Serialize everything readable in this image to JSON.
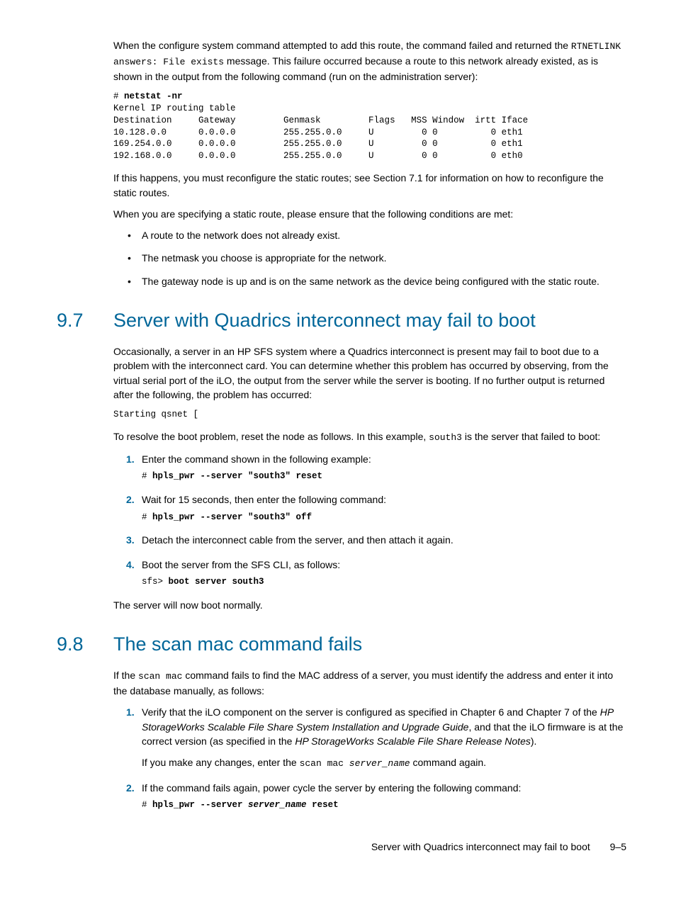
{
  "intro": {
    "p1_a": "When the configure system command attempted to add this route, the command failed and returned the ",
    "p1_code": "RTNETLINK answers: File exists",
    "p1_b": " message. This failure occurred because a route to this network already existed, as is shown in the output from the following command (run on the administration server):",
    "codeblock": "# netstat -nr\nKernel IP routing table\nDestination     Gateway         Genmask         Flags   MSS Window  irtt Iface\n10.128.0.0      0.0.0.0         255.255.0.0     U         0 0          0 eth1\n169.254.0.0     0.0.0.0         255.255.0.0     U         0 0          0 eth1\n192.168.0.0     0.0.0.0         255.255.0.0     U         0 0          0 eth0",
    "p2": "If this happens, you must reconfigure the static routes; see Section 7.1 for information on how to reconfigure the static routes.",
    "p3": "When you are specifying a static route, please ensure that the following conditions are met:",
    "bullets": [
      "A route to the network does not already exist.",
      "The netmask you choose is appropriate for the network.",
      "The gateway node is up and is on the same network as the device being configured with the static route."
    ]
  },
  "s97": {
    "num": "9.7",
    "title": "Server with Quadrics interconnect may fail to boot",
    "p1": "Occasionally, a server in an HP SFS system where a Quadrics interconnect is present may fail to boot due to a problem with the interconnect card. You can determine whether this problem has occurred by observing, from the virtual serial port of the iLO, the output from the server while the server is booting. If no further output is returned after the following, the problem has occurred:",
    "code1": "Starting qsnet [",
    "p2_a": "To resolve the boot problem, reset the node as follows. In this example, ",
    "p2_code": "south3",
    "p2_b": " is the server that failed to boot:",
    "steps": [
      {
        "text": "Enter the command shown in the following example:",
        "code_pre": "# ",
        "code_bold": "hpls_pwr --server \"south3\" reset"
      },
      {
        "text": "Wait for 15 seconds, then enter the following command:",
        "code_pre": "# ",
        "code_bold": "hpls_pwr --server \"south3\" off"
      },
      {
        "text": "Detach the interconnect cable from the server, and then attach it again."
      },
      {
        "text": "Boot the server from the SFS CLI, as follows:",
        "code_pre": "sfs> ",
        "code_bold": "boot server south3"
      }
    ],
    "p3": "The server will now boot normally."
  },
  "s98": {
    "num": "9.8",
    "title": "The scan mac command fails",
    "p1_a": "If the ",
    "p1_code": "scan mac",
    "p1_b": " command fails to find the MAC address of a server, you must identify the address and enter it into the database manually, as follows:",
    "steps": [
      {
        "pa": "Verify that the iLO component on the server is configured as specified in Chapter 6 and Chapter 7 of the ",
        "em1": "HP StorageWorks Scalable File Share System Installation and Upgrade Guide",
        "pb": ", and that the iLO firmware is at the correct version (as specified in the ",
        "em2": "HP StorageWorks Scalable File Share Release Notes",
        "pc": ").",
        "p2a": "If you make any changes, enter the ",
        "p2code1": "scan mac ",
        "p2code_em": "server_name",
        "p2b": " command again."
      },
      {
        "text": "If the command fails again, power cycle the server by entering the following command:",
        "code_pre": "# ",
        "code_bold_a": "hpls_pwr --server ",
        "code_bold_em": "server_name",
        "code_bold_b": " reset"
      }
    ]
  },
  "footer": {
    "text": "Server with Quadrics interconnect may fail to boot",
    "page": "9–5"
  }
}
